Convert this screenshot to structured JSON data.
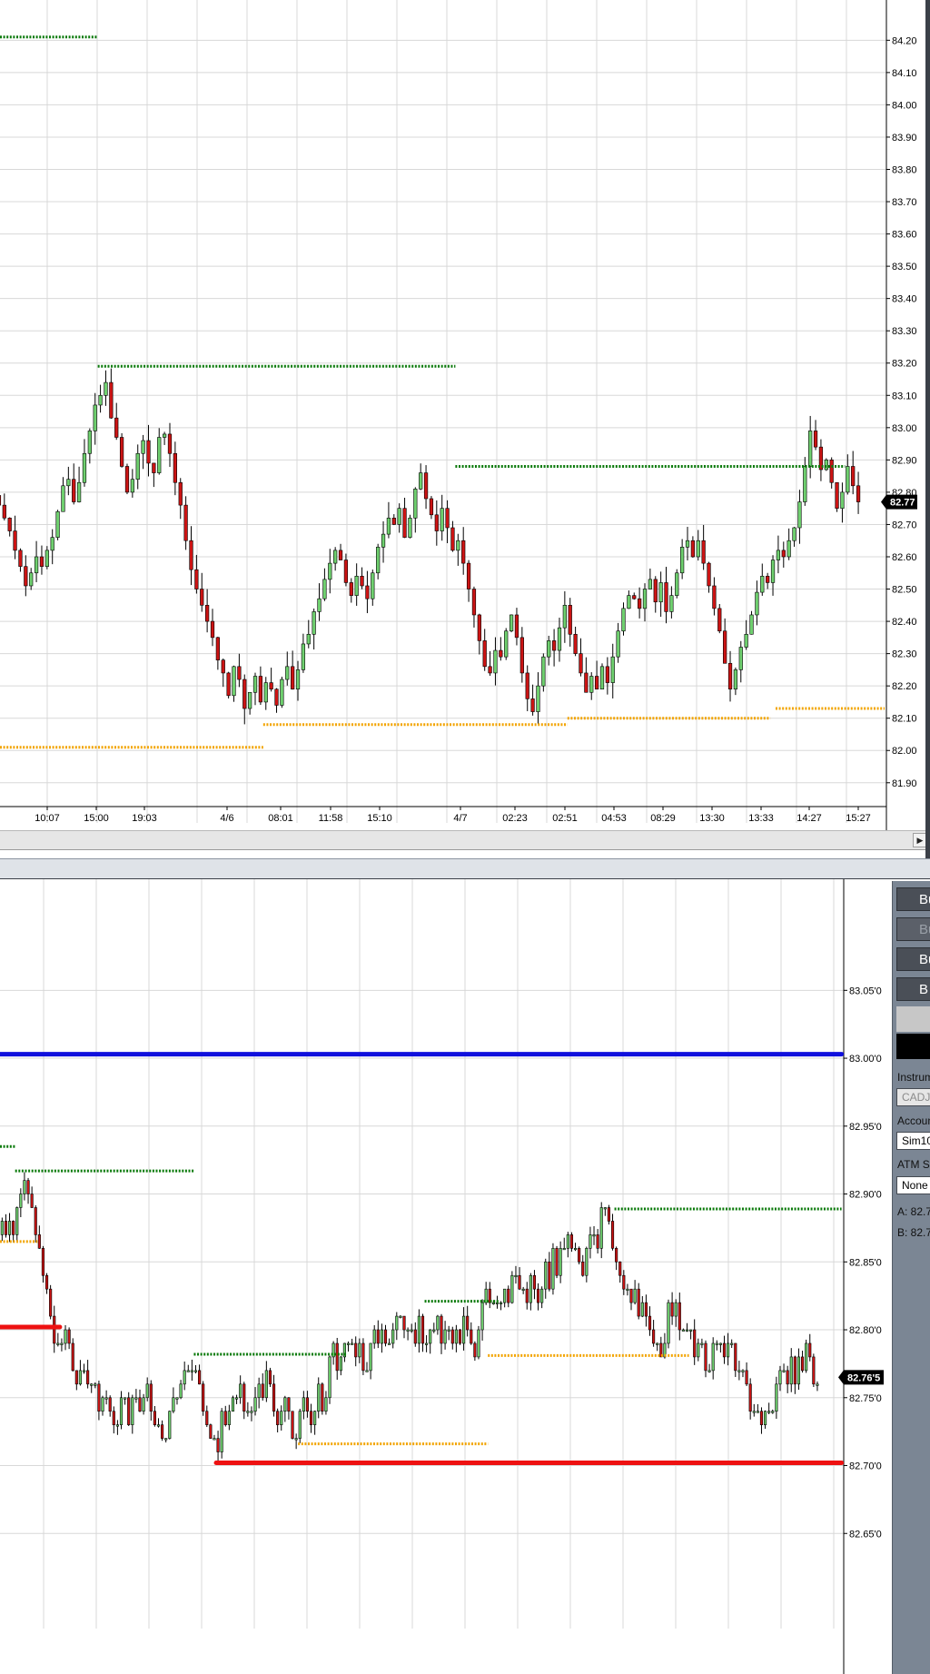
{
  "chart_data": [
    {
      "type": "candlestick",
      "title": "",
      "ylim": [
        81.86,
        84.26
      ],
      "y_ticks": [
        "84.20",
        "84.10",
        "84.00",
        "83.90",
        "83.80",
        "83.70",
        "83.60",
        "83.50",
        "83.40",
        "83.30",
        "83.20",
        "83.10",
        "83.00",
        "82.90",
        "82.80",
        "82.70",
        "82.60",
        "82.50",
        "82.40",
        "82.30",
        "82.20",
        "82.10",
        "82.00",
        "81.90"
      ],
      "x_tick_labels": [
        "10:07",
        "15:00",
        "19:03",
        "4/6",
        "08:01",
        "11:58",
        "15:10",
        "4/7",
        "02:23",
        "02:51",
        "04:53",
        "08:29",
        "13:30",
        "13:33",
        "14:27",
        "15:27"
      ],
      "last_price_label": "82.77",
      "closes": [
        82.76,
        82.72,
        82.68,
        82.62,
        82.57,
        82.51,
        82.55,
        82.6,
        82.57,
        82.62,
        82.66,
        82.74,
        82.82,
        82.84,
        82.77,
        82.83,
        82.92,
        82.99,
        83.07,
        83.1,
        83.14,
        83.03,
        82.97,
        82.88,
        82.8,
        82.84,
        82.92,
        82.96,
        82.89,
        82.86,
        82.97,
        82.98,
        82.92,
        82.83,
        82.76,
        82.65,
        82.56,
        82.5,
        82.45,
        82.4,
        82.35,
        82.28,
        82.24,
        82.17,
        82.26,
        82.22,
        82.13,
        82.18,
        82.23,
        82.15,
        82.21,
        82.19,
        82.14,
        82.22,
        82.26,
        82.19,
        82.25,
        82.33,
        82.36,
        82.43,
        82.47,
        82.53,
        82.58,
        82.62,
        82.59,
        82.52,
        82.48,
        82.54,
        82.51,
        82.47,
        82.55,
        82.63,
        82.67,
        82.72,
        82.7,
        82.75,
        82.66,
        82.72,
        82.81,
        82.86,
        82.78,
        82.73,
        82.68,
        82.75,
        82.69,
        82.62,
        82.65,
        82.58,
        82.5,
        82.42,
        82.34,
        82.26,
        82.24,
        82.31,
        82.29,
        82.37,
        82.42,
        82.35,
        82.24,
        82.16,
        82.12,
        82.2,
        82.29,
        82.34,
        82.31,
        82.38,
        82.45,
        82.36,
        82.3,
        82.24,
        82.18,
        82.23,
        82.19,
        82.26,
        82.21,
        82.29,
        82.37,
        82.44,
        82.48,
        82.47,
        82.44,
        82.5,
        82.53,
        82.46,
        82.52,
        82.43,
        82.48,
        82.55,
        82.63,
        82.65,
        82.6,
        82.65,
        82.58,
        82.51,
        82.44,
        82.37,
        82.27,
        82.19,
        82.25,
        82.32,
        82.36,
        82.42,
        82.49,
        82.54,
        82.52,
        82.59,
        82.62,
        82.6,
        82.65,
        82.69,
        82.77,
        82.88,
        82.99,
        82.94,
        82.87,
        82.9,
        82.83,
        82.75,
        82.8,
        82.88,
        82.82,
        82.77
      ],
      "levels": [
        {
          "value": 84.21,
          "from_index": -4,
          "to_index": 19,
          "color": "#0b7a0b",
          "style": "dotted"
        },
        {
          "value": 83.19,
          "from_index": 19,
          "to_index": 86,
          "color": "#0b7a0b",
          "style": "dotted"
        },
        {
          "value": 82.88,
          "from_index": 86,
          "to_index": 159,
          "color": "#0b7a0b",
          "style": "dotted"
        },
        {
          "value": 82.01,
          "from_index": -4,
          "to_index": 50,
          "color": "#f2a400",
          "style": "dotted"
        },
        {
          "value": 82.08,
          "from_index": 50,
          "to_index": 107,
          "color": "#f2a400",
          "style": "dotted"
        },
        {
          "value": 82.1,
          "from_index": 107,
          "to_index": 145,
          "color": "#f2a400",
          "style": "dotted"
        },
        {
          "value": 82.13,
          "from_index": 146,
          "to_index": 173,
          "color": "#f2a400",
          "style": "dotted"
        }
      ]
    },
    {
      "type": "candlestick",
      "title": "",
      "ylim": [
        82.6,
        83.085
      ],
      "y_ticks": [
        "83.05'0",
        "83.00'0",
        "82.95'0",
        "82.90'0",
        "82.85'0",
        "82.80'0",
        "82.75'0",
        "82.70'0",
        "82.65'0"
      ],
      "last_price_label": "82.76'5",
      "closes": [
        82.87,
        82.88,
        82.87,
        82.88,
        82.87,
        82.88,
        82.87,
        82.89,
        82.9,
        82.91,
        82.9,
        82.89,
        82.87,
        82.86,
        82.84,
        82.83,
        82.81,
        82.79,
        82.79,
        82.79,
        82.8,
        82.79,
        82.77,
        82.76,
        82.77,
        82.77,
        82.76,
        82.76,
        82.76,
        82.74,
        82.75,
        82.75,
        82.74,
        82.73,
        82.73,
        82.75,
        82.75,
        82.73,
        82.75,
        82.75,
        82.74,
        82.75,
        82.76,
        82.74,
        82.73,
        82.73,
        82.72,
        82.72,
        82.74,
        82.75,
        82.75,
        82.76,
        82.77,
        82.77,
        82.77,
        82.77,
        82.76,
        82.74,
        82.73,
        82.72,
        82.72,
        82.71,
        82.74,
        82.73,
        82.74,
        82.75,
        82.75,
        82.76,
        82.74,
        82.74,
        82.74,
        82.75,
        82.76,
        82.75,
        82.77,
        82.76,
        82.74,
        82.73,
        82.74,
        82.75,
        82.74,
        82.72,
        82.72,
        82.74,
        82.75,
        82.74,
        82.73,
        82.74,
        82.76,
        82.74,
        82.75,
        82.78,
        82.79,
        82.77,
        82.78,
        82.79,
        82.79,
        82.79,
        82.78,
        82.79,
        82.77,
        82.77,
        82.79,
        82.8,
        82.79,
        82.8,
        82.79,
        82.79,
        82.8,
        82.81,
        82.81,
        82.8,
        82.8,
        82.8,
        82.79,
        82.81,
        82.79,
        82.79,
        82.8,
        82.8,
        82.81,
        82.79,
        82.8,
        82.8,
        82.79,
        82.8,
        82.79,
        82.81,
        82.8,
        82.79,
        82.78,
        82.8,
        82.82,
        82.83,
        82.82,
        82.82,
        82.82,
        82.82,
        82.83,
        82.82,
        82.84,
        82.84,
        82.83,
        82.83,
        82.82,
        82.84,
        82.83,
        82.82,
        82.83,
        82.85,
        82.83,
        82.86,
        82.84,
        82.86,
        82.86,
        82.87,
        82.86,
        82.86,
        82.85,
        82.84,
        82.86,
        82.87,
        82.87,
        82.86,
        82.89,
        82.89,
        82.88,
        82.86,
        82.85,
        82.84,
        82.83,
        82.83,
        82.82,
        82.83,
        82.81,
        82.82,
        82.81,
        82.8,
        82.79,
        82.79,
        82.78,
        82.79,
        82.82,
        82.81,
        82.82,
        82.8,
        82.8,
        82.8,
        82.8,
        82.78,
        82.79,
        82.79,
        82.77,
        82.77,
        82.79,
        82.79,
        82.79,
        82.78,
        82.79,
        82.79,
        82.77,
        82.77,
        82.77,
        82.76,
        82.74,
        82.74,
        82.74,
        82.73,
        82.74,
        82.74,
        82.74,
        82.76,
        82.77,
        82.77,
        82.76,
        82.78,
        82.76,
        82.78,
        82.77,
        82.79,
        82.78,
        82.76,
        82.76
      ],
      "levels": [
        {
          "value": 83.003,
          "from_index": -4,
          "to_index": 229,
          "color": "#1010dd",
          "style": "solid-thick"
        },
        {
          "value": 82.935,
          "from_index": -4,
          "to_index": 7,
          "color": "#0b7a0b",
          "style": "dotted"
        },
        {
          "value": 82.917,
          "from_index": 7,
          "to_index": 55,
          "color": "#0b7a0b",
          "style": "dotted"
        },
        {
          "value": 82.865,
          "from_index": -4,
          "to_index": 13,
          "color": "#f2a400",
          "style": "dotted"
        },
        {
          "value": 82.802,
          "from_index": -4,
          "to_index": 19,
          "color": "#ee1111",
          "style": "solid-thick"
        },
        {
          "value": 82.782,
          "from_index": 55,
          "to_index": 96,
          "color": "#0b7a0b",
          "style": "dotted"
        },
        {
          "value": 82.716,
          "from_index": 83,
          "to_index": 134,
          "color": "#f2a400",
          "style": "dotted"
        },
        {
          "value": 82.702,
          "from_index": 61,
          "to_index": 229,
          "color": "#ee1111",
          "style": "solid-thick"
        },
        {
          "value": 82.821,
          "from_index": 117,
          "to_index": 137,
          "color": "#0b7a0b",
          "style": "dotted"
        },
        {
          "value": 82.781,
          "from_index": 134,
          "to_index": 188,
          "color": "#f2a400",
          "style": "dotted"
        },
        {
          "value": 82.889,
          "from_index": 168,
          "to_index": 229,
          "color": "#0b7a0b",
          "style": "dotted"
        }
      ]
    }
  ],
  "side_panel": {
    "buttons": [
      "Bu",
      "Bu",
      "Bu",
      "B"
    ],
    "instrument_label": "Instrum",
    "instrument_value": "CADJ",
    "account_label": "Accoun",
    "account_value": "Sim10",
    "atm_label": "ATM Str",
    "atm_value": "None",
    "ask": "A:  82.7",
    "bid": "B:  82.7"
  },
  "colors": {
    "up_candle": "#6fd06f",
    "down_candle": "#cc1414",
    "grid": "#d8d8d8",
    "last_price_bg": "#000000"
  }
}
